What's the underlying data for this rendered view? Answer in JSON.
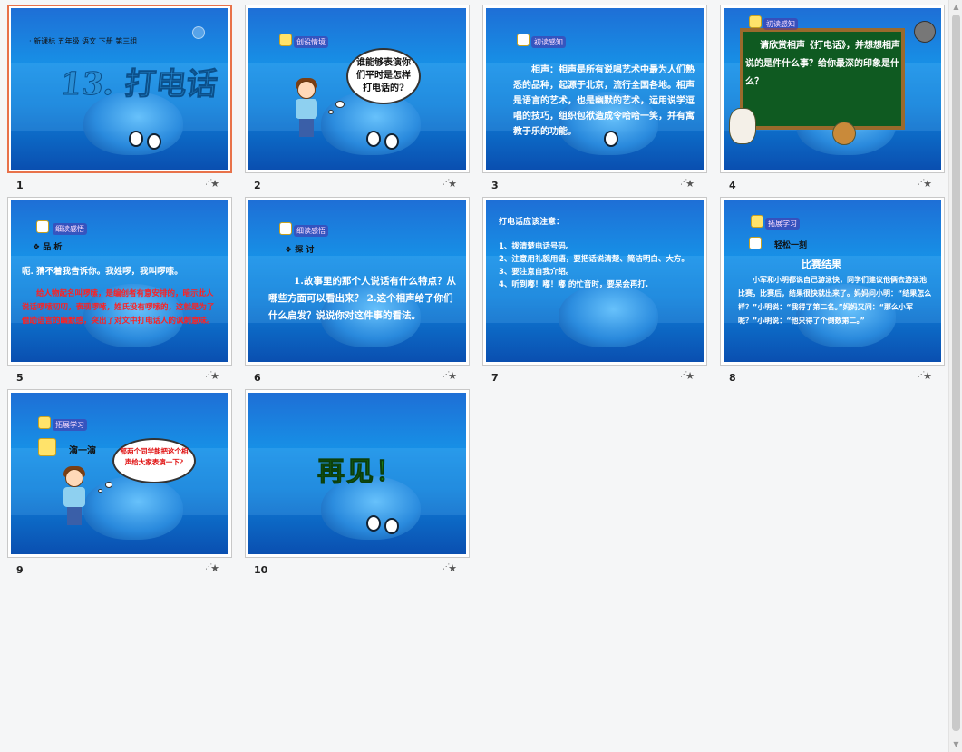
{
  "slides": [
    {
      "number": "1",
      "lines": [
        "· 新课标 五年级 语文 下册 第三组",
        "13. 打电话"
      ]
    },
    {
      "number": "2",
      "tag": "创设情境",
      "bubble": "谁能够表演你们平时是怎样打电话的?"
    },
    {
      "number": "3",
      "tag": "初读感知",
      "body": "相声：相声是所有说唱艺术中最为人们熟悉的品种，起源于北京，流行全国各地。相声是语言的艺术，也是幽默的艺术，运用说学逗唱的技巧，组织包袱造成令哈哈一笑，并有寓教于乐的功能。"
    },
    {
      "number": "4",
      "tag": "初读感知",
      "body": "请欣赏相声《打电话》，并想想相声说的是件什么事？给你最深的印象是什么？"
    },
    {
      "number": "5",
      "tag": "细读感悟",
      "heading": "❖ 品 析",
      "line1": "呃. 猜不着我告诉你。我姓啰，我叫啰嗦。",
      "body": "给人物起名叫啰嗦，是编创者有意安排的，暗示此人说话啰嗦叨叨，表现啰嗦，姓氏没有啰嗦的，这就是为了借助语言的幽默感，突出了对文中打电话人的讽刺意味。"
    },
    {
      "number": "6",
      "tag": "细读感悟",
      "heading": "❖ 探 讨",
      "body": "1.故事里的那个人说话有什么特点？从哪些方面可以看出来？ 2.这个相声给了你们什么启发？说说你对这件事的看法。"
    },
    {
      "number": "7",
      "title": "打电话应该注意：",
      "items": [
        "1、拨清楚电话号码。",
        "2、注意用礼貌用语，要把话说清楚、简洁明白、大方。",
        "3、要注意自我介绍。",
        "4、听到嘟！嘟！嘟 的忙音时，要呆会再打."
      ]
    },
    {
      "number": "8",
      "tag": "拓展学习",
      "sub": "轻松一刻",
      "heading": "比赛结果",
      "body": "小军和小明都说自己游泳快，同学们建议他俩去游泳池比赛。比赛后，结果很快就出来了。妈妈问小明：“结果怎么样？”小明说：“我得了第二名。”妈妈又问：“那么小军呢？”小明说：“他只得了个倒数第二。”"
    },
    {
      "number": "9",
      "tag": "拓展学习",
      "sub": "演一演",
      "bubble": "那两个同学能把这个相声给大家表演一下?"
    },
    {
      "number": "10",
      "title": "再见！"
    }
  ],
  "star_label": "★"
}
